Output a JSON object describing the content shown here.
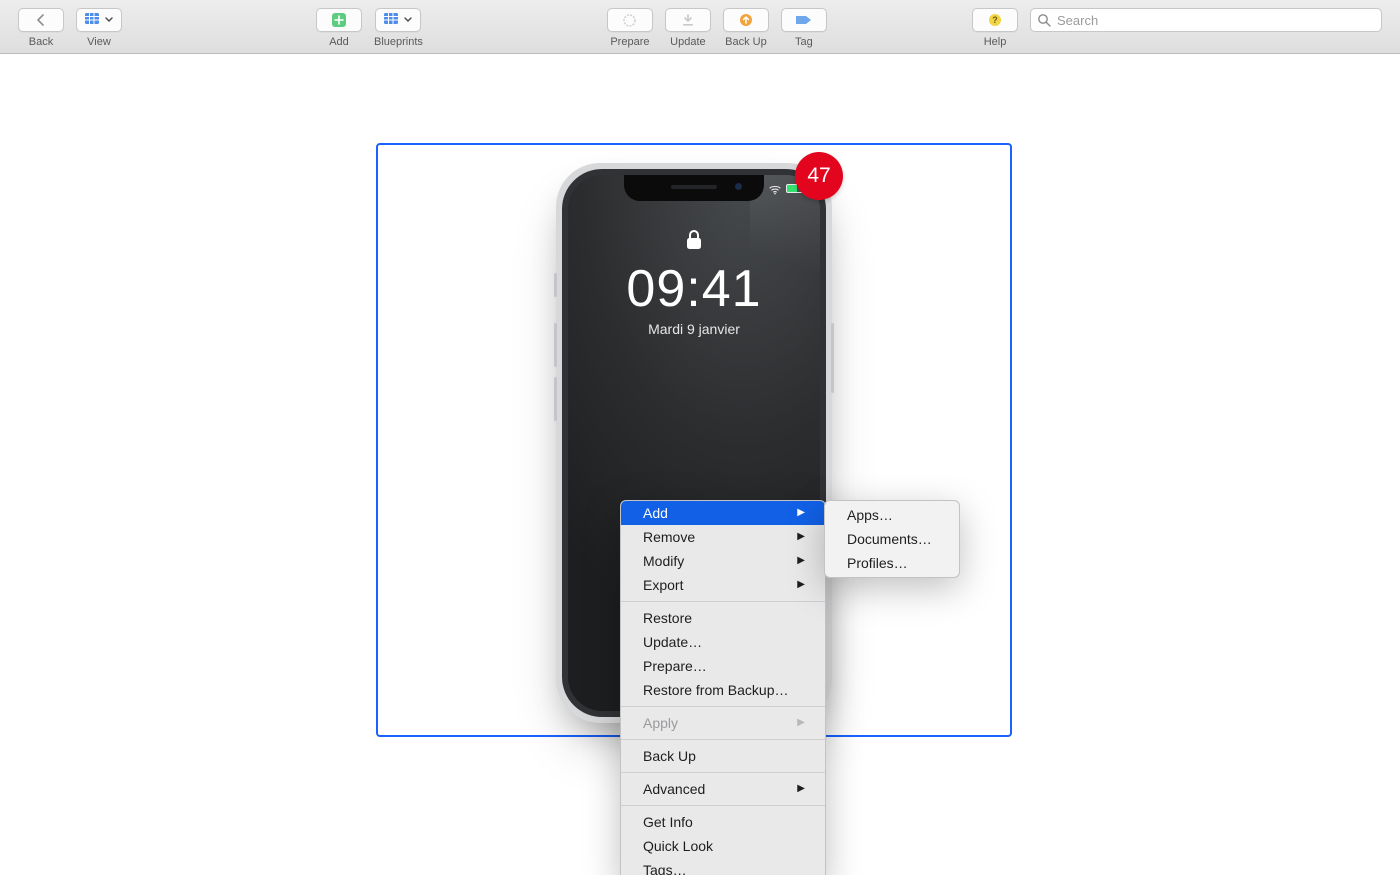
{
  "toolbar": {
    "back_label": "Back",
    "view_label": "View",
    "add_label": "Add",
    "blueprints_label": "Blueprints",
    "prepare_label": "Prepare",
    "update_label": "Update",
    "backup_label": "Back Up",
    "tag_label": "Tag",
    "help_label": "Help"
  },
  "search": {
    "placeholder": "Search",
    "value": ""
  },
  "device": {
    "badge_count": "47",
    "time": "09:41",
    "date": "Mardi 9 janvier"
  },
  "context_menu": {
    "items": [
      {
        "label": "Add",
        "submenu": true,
        "selected": true
      },
      {
        "label": "Remove",
        "submenu": true
      },
      {
        "label": "Modify",
        "submenu": true
      },
      {
        "label": "Export",
        "submenu": true
      },
      {
        "separator": true
      },
      {
        "label": "Restore"
      },
      {
        "label": "Update…"
      },
      {
        "label": "Prepare…"
      },
      {
        "label": "Restore from Backup…"
      },
      {
        "separator": true
      },
      {
        "label": "Apply",
        "submenu": true,
        "disabled": true
      },
      {
        "separator": true
      },
      {
        "label": "Back Up"
      },
      {
        "separator": true
      },
      {
        "label": "Advanced",
        "submenu": true
      },
      {
        "separator": true
      },
      {
        "label": "Get Info"
      },
      {
        "label": "Quick Look"
      },
      {
        "label": "Tags…"
      }
    ],
    "submenu": {
      "items": [
        {
          "label": "Apps…"
        },
        {
          "label": "Documents…"
        },
        {
          "label": "Profiles…"
        }
      ]
    }
  }
}
